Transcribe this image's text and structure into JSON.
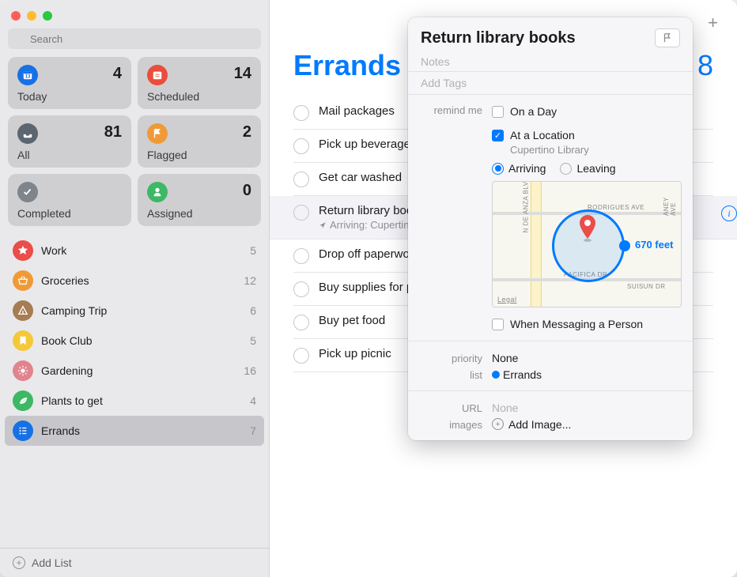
{
  "search": {
    "placeholder": "Search"
  },
  "smart": [
    {
      "label": "Today",
      "count": "4",
      "color": "#1771E6"
    },
    {
      "label": "Scheduled",
      "count": "14",
      "color": "#EB4D3D"
    },
    {
      "label": "All",
      "count": "81",
      "color": "#5B6670"
    },
    {
      "label": "Flagged",
      "count": "2",
      "color": "#F09A37"
    },
    {
      "label": "Completed",
      "count": "",
      "color": "#7F858B"
    },
    {
      "label": "Assigned",
      "count": "0",
      "color": "#3DB864"
    }
  ],
  "lists": [
    {
      "label": "Work",
      "count": "5",
      "color": "#EB4D49"
    },
    {
      "label": "Groceries",
      "count": "12",
      "color": "#F09A37"
    },
    {
      "label": "Camping Trip",
      "count": "6",
      "color": "#A67C52"
    },
    {
      "label": "Book Club",
      "count": "5",
      "color": "#F4C838"
    },
    {
      "label": "Gardening",
      "count": "16",
      "color": "#E1848D"
    },
    {
      "label": "Plants to get",
      "count": "4",
      "color": "#3DB864"
    },
    {
      "label": "Errands",
      "count": "7",
      "color": "#1771E6",
      "selected": true
    }
  ],
  "addList": "Add List",
  "main": {
    "title": "Errands",
    "count": "8",
    "items": [
      {
        "title": "Mail packages"
      },
      {
        "title": "Pick up beverages"
      },
      {
        "title": "Get car washed"
      },
      {
        "title": "Return library books",
        "sub": "Arriving: Cupertino Library",
        "selected": true
      },
      {
        "title": "Drop off paperwork"
      },
      {
        "title": "Buy supplies for party"
      },
      {
        "title": "Buy pet food"
      },
      {
        "title": "Pick up picnic"
      }
    ]
  },
  "popover": {
    "title": "Return library books",
    "notesPlaceholder": "Notes",
    "tagsPlaceholder": "Add Tags",
    "remindMeLabel": "remind me",
    "onADay": "On a Day",
    "atLocation": "At a Location",
    "locationName": "Cupertino Library",
    "arriving": "Arriving",
    "leaving": "Leaving",
    "geofenceDistance": "670 feet",
    "whenMessaging": "When Messaging a Person",
    "priorityLabel": "priority",
    "priorityValue": "None",
    "listLabel": "list",
    "listValue": "Errands",
    "urlLabel": "URL",
    "urlValue": "None",
    "imagesLabel": "images",
    "addImage": "Add Image...",
    "mapStreets": {
      "deAnza": "N DE ANZA BLVD",
      "rodrigues": "RODRIGUES AVE",
      "pacifica": "PACIFICA DR",
      "suisun": "SUISUN DR",
      "aney": "ANEY AVE",
      "legal": "Legal"
    }
  }
}
